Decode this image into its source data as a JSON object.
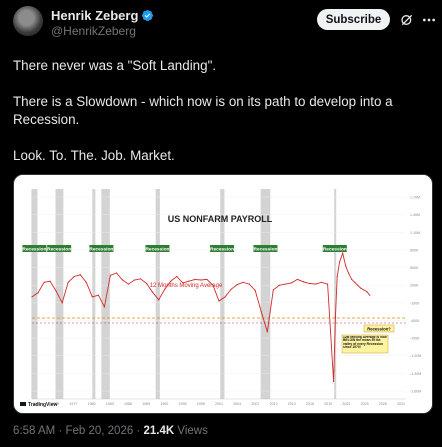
{
  "author": {
    "name": "Henrik Zeberg",
    "handle": "@HenrikZeberg",
    "avatar_icon": "avatar-photo"
  },
  "actions": {
    "subscribe_label": "Subscribe",
    "grok_icon": "grok-icon",
    "more_icon": "more-icon"
  },
  "tweet": {
    "paragraphs": [
      "There never was a \"Soft Landing\".",
      "There is a Slowdown - which now is on its path to develop into a Recession.",
      "Look. To. The. Job. Market."
    ]
  },
  "footer": {
    "time": "6:58 AM",
    "separator": "·",
    "date": "Feb 20, 2026",
    "views_count": "21.4K",
    "views_label": "Views"
  },
  "colors": {
    "background": "#000000",
    "text": "#e7e9ea",
    "muted": "#71767b",
    "verified": "#1d9bf0",
    "series": "#d42a2a",
    "recession_band": "#c8c8c8",
    "recession_label_bg": "#2e7d32"
  },
  "chart_data": {
    "type": "line",
    "title": "US NONFARM PAYROLL",
    "annotation_ma": "12 Months Moving Average",
    "watermark": "TradingView",
    "recession_label": "Recession",
    "recession_question": "Recession?",
    "note_box": "12M Moving Average is now BELOW the mean of the valley of every Recession since 1970!",
    "xticks": [
      "1971",
      "1973",
      "1977",
      "1980",
      "1983",
      "1986",
      "1989",
      "1992",
      "1995",
      "1998",
      "2001",
      "2004",
      "2007",
      "2010",
      "2013",
      "2016",
      "2019",
      "2022",
      "2025",
      "2028",
      "2031"
    ],
    "yticks": [
      "1.70M",
      "1.40M",
      "1.10M",
      "800K",
      "500K",
      "200K",
      "-100K",
      "-400K",
      "-700K",
      "-1.00M",
      "-1.30M",
      "-1.60M"
    ],
    "ylim": [
      -1.8,
      1.8
    ],
    "recessions": [
      [
        1969.9,
        1970.9
      ],
      [
        1973.9,
        1975.2
      ],
      [
        1980.0,
        1980.5
      ],
      [
        1981.5,
        1982.9
      ],
      [
        1990.5,
        1991.2
      ],
      [
        2001.2,
        2001.9
      ],
      [
        2007.9,
        2009.5
      ],
      [
        2020.1,
        2020.3
      ]
    ],
    "recession_labels_x": [
      1970.4,
      1974.5,
      1981.5,
      1990.8,
      2001.5,
      2008.7,
      2020.2
    ],
    "series": [
      {
        "name": "12 Months Moving Average",
        "x": [
          1970,
          1971,
          1972,
          1973,
          1974,
          1975,
          1976,
          1977,
          1978,
          1979,
          1980,
          1981,
          1982,
          1983,
          1984,
          1985,
          1986,
          1987,
          1988,
          1989,
          1990,
          1991,
          1992,
          1993,
          1994,
          1995,
          1996,
          1997,
          1998,
          1999,
          2000,
          2001,
          2002,
          2003,
          2004,
          2005,
          2006,
          2007,
          2008,
          2009,
          2010,
          2011,
          2012,
          2013,
          2014,
          2015,
          2016,
          2017,
          2018,
          2019,
          2020,
          2020.3,
          2020.6,
          2021,
          2021.5,
          2022,
          2022.5,
          2023,
          2023.5,
          2024,
          2024.5,
          2025,
          2025.5,
          2026
        ],
        "values": [
          -0.05,
          0.02,
          0.2,
          0.22,
          0.05,
          -0.15,
          0.2,
          0.3,
          0.33,
          0.2,
          -0.05,
          -0.02,
          -0.22,
          0.32,
          0.36,
          0.24,
          0.17,
          0.24,
          0.26,
          0.18,
          0.03,
          -0.1,
          0.08,
          0.22,
          0.3,
          0.19,
          0.22,
          0.25,
          0.24,
          0.25,
          0.15,
          -0.12,
          -0.05,
          0.08,
          0.16,
          0.2,
          0.17,
          0.06,
          -0.3,
          -0.65,
          0.07,
          0.15,
          0.17,
          0.19,
          0.25,
          0.21,
          0.18,
          0.17,
          0.2,
          0.17,
          -1.5,
          -0.4,
          0.3,
          0.55,
          0.7,
          0.48,
          0.35,
          0.25,
          0.2,
          0.15,
          0.1,
          0.07,
          0.04,
          -0.02
        ]
      }
    ]
  }
}
